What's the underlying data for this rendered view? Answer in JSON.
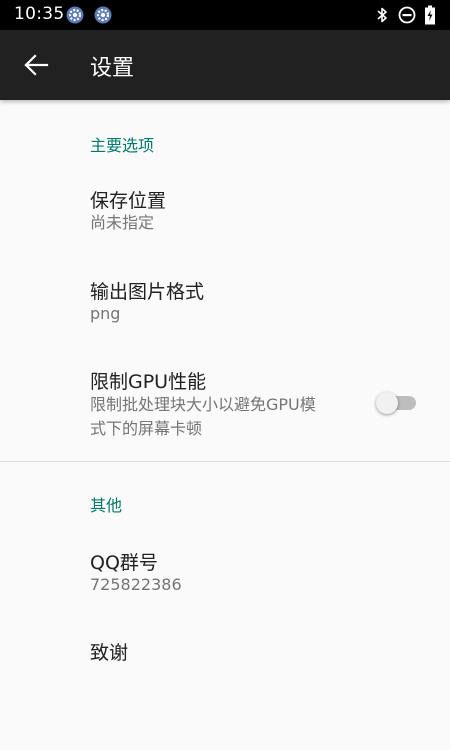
{
  "status_bar": {
    "time": "10:35",
    "left_icons": [
      "settings-gear-icon",
      "settings-gear-icon"
    ],
    "right_icons": [
      "bluetooth-icon",
      "do-not-disturb-icon",
      "battery-charging-icon"
    ]
  },
  "app_bar": {
    "title": "设置",
    "back_icon": "arrow-back-icon"
  },
  "sections": {
    "main": {
      "header": "主要选项"
    },
    "other": {
      "header": "其他"
    }
  },
  "prefs": {
    "save_location": {
      "title": "保存位置",
      "summary": "尚未指定"
    },
    "output_format": {
      "title": "输出图片格式",
      "summary": "png"
    },
    "limit_gpu": {
      "title": "限制GPU性能",
      "summary_line1": "限制批处理块大小以避免GPU模",
      "summary_line2": "式下的屏幕卡顿",
      "enabled": false
    },
    "qq_group": {
      "title": "QQ群号",
      "summary": "725822386"
    },
    "thanks": {
      "title": "致谢"
    }
  },
  "colors": {
    "accent": "#00796b",
    "app_bar": "#212121",
    "background": "#fafafa"
  }
}
